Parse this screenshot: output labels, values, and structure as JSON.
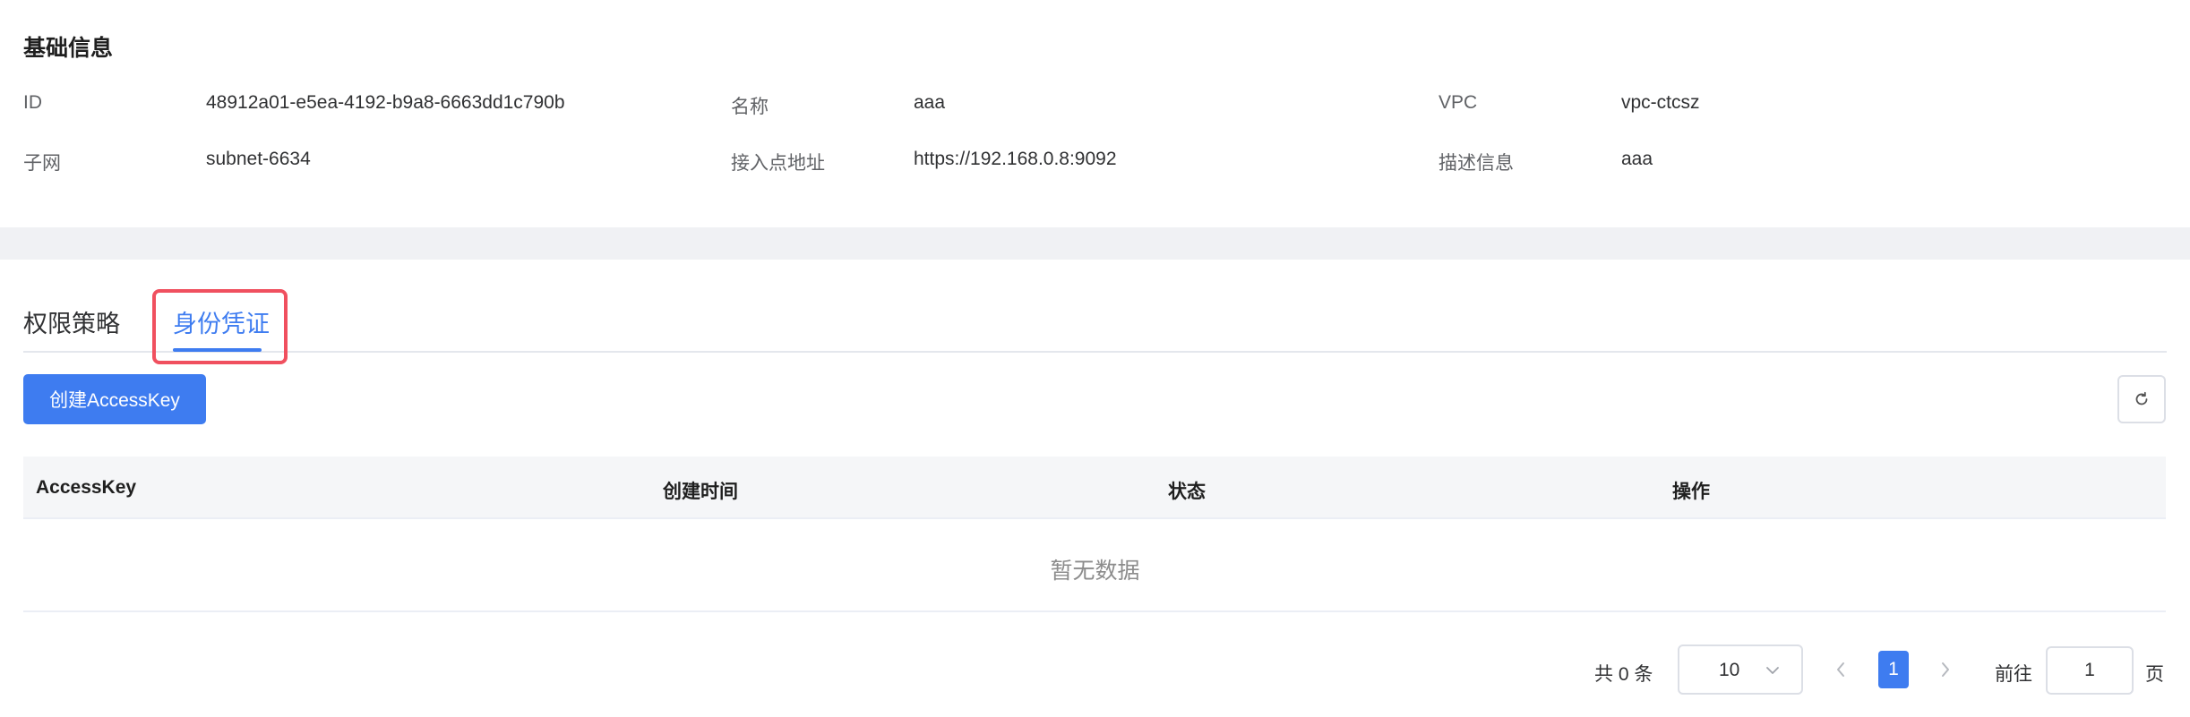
{
  "basic_info": {
    "title": "基础信息",
    "fields": [
      {
        "label": "ID",
        "value": "48912a01-e5ea-4192-b9a8-6663dd1c790b"
      },
      {
        "label": "名称",
        "value": "aaa"
      },
      {
        "label": "VPC",
        "value": "vpc-ctcsz"
      },
      {
        "label": "子网",
        "value": "subnet-6634"
      },
      {
        "label": "接入点地址",
        "value": "https://192.168.0.8:9092"
      },
      {
        "label": "描述信息",
        "value": "aaa"
      }
    ]
  },
  "tabs": [
    {
      "label": "权限策略",
      "active": false
    },
    {
      "label": "身份凭证",
      "active": true
    }
  ],
  "toolbar": {
    "create_label": "创建AccessKey",
    "refresh_icon": "refresh-icon"
  },
  "table": {
    "columns": [
      "AccessKey",
      "创建时间",
      "状态",
      "操作"
    ],
    "rows": [],
    "empty_text": "暂无数据"
  },
  "pagination": {
    "total_text": "共 0 条",
    "page_size": "10",
    "current_page": "1",
    "goto_label": "前往",
    "goto_value": "1",
    "goto_suffix": "页"
  },
  "colors": {
    "accent": "#3e7cf0",
    "highlight": "#f0505f",
    "band": "#f0f1f4"
  }
}
